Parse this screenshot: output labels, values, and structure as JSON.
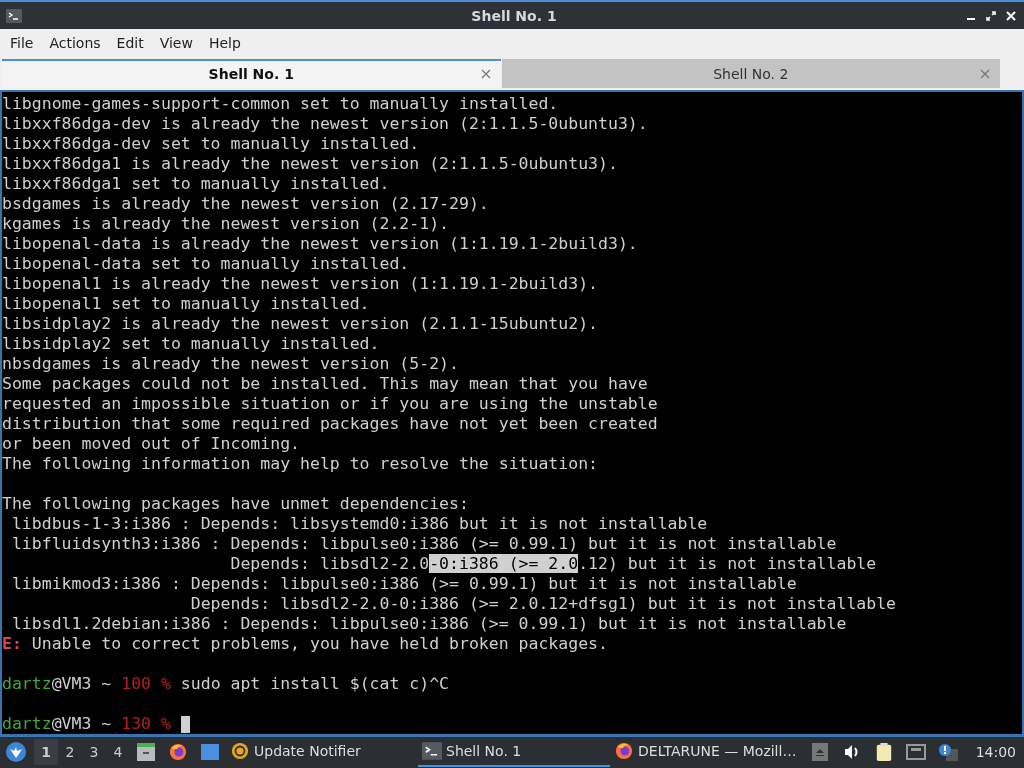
{
  "window": {
    "title": "Shell No. 1"
  },
  "menu": [
    "File",
    "Actions",
    "Edit",
    "View",
    "Help"
  ],
  "tabs": [
    {
      "label": "Shell No. 1",
      "selected": true
    },
    {
      "label": "Shell No. 2",
      "selected": false
    }
  ],
  "terminal": {
    "lines": [
      {
        "spans": [
          {
            "kind": "plain",
            "text": "libgnome-games-support-common set to manually installed."
          }
        ]
      },
      {
        "spans": [
          {
            "kind": "plain",
            "text": "libxxf86dga-dev is already the newest version (2:1.1.5-0ubuntu3)."
          }
        ]
      },
      {
        "spans": [
          {
            "kind": "plain",
            "text": "libxxf86dga-dev set to manually installed."
          }
        ]
      },
      {
        "spans": [
          {
            "kind": "plain",
            "text": "libxxf86dga1 is already the newest version (2:1.1.5-0ubuntu3)."
          }
        ]
      },
      {
        "spans": [
          {
            "kind": "plain",
            "text": "libxxf86dga1 set to manually installed."
          }
        ]
      },
      {
        "spans": [
          {
            "kind": "plain",
            "text": "bsdgames is already the newest version (2.17-29)."
          }
        ]
      },
      {
        "spans": [
          {
            "kind": "plain",
            "text": "kgames is already the newest version (2.2-1)."
          }
        ]
      },
      {
        "spans": [
          {
            "kind": "plain",
            "text": "libopenal-data is already the newest version (1:1.19.1-2build3)."
          }
        ]
      },
      {
        "spans": [
          {
            "kind": "plain",
            "text": "libopenal-data set to manually installed."
          }
        ]
      },
      {
        "spans": [
          {
            "kind": "plain",
            "text": "libopenal1 is already the newest version (1:1.19.1-2build3)."
          }
        ]
      },
      {
        "spans": [
          {
            "kind": "plain",
            "text": "libopenal1 set to manually installed."
          }
        ]
      },
      {
        "spans": [
          {
            "kind": "plain",
            "text": "libsidplay2 is already the newest version (2.1.1-15ubuntu2)."
          }
        ]
      },
      {
        "spans": [
          {
            "kind": "plain",
            "text": "libsidplay2 set to manually installed."
          }
        ]
      },
      {
        "spans": [
          {
            "kind": "plain",
            "text": "nbsdgames is already the newest version (5-2)."
          }
        ]
      },
      {
        "spans": [
          {
            "kind": "plain",
            "text": "Some packages could not be installed. This may mean that you have"
          }
        ]
      },
      {
        "spans": [
          {
            "kind": "plain",
            "text": "requested an impossible situation or if you are using the unstable"
          }
        ]
      },
      {
        "spans": [
          {
            "kind": "plain",
            "text": "distribution that some required packages have not yet been created"
          }
        ]
      },
      {
        "spans": [
          {
            "kind": "plain",
            "text": "or been moved out of Incoming."
          }
        ]
      },
      {
        "spans": [
          {
            "kind": "plain",
            "text": "The following information may help to resolve the situation:"
          }
        ]
      },
      {
        "kind": "blank"
      },
      {
        "spans": [
          {
            "kind": "plain",
            "text": "The following packages have unmet dependencies:"
          }
        ]
      },
      {
        "spans": [
          {
            "kind": "plain",
            "text": " libdbus-1-3:i386 : Depends: libsystemd0:i386 but it is not installable"
          }
        ]
      },
      {
        "spans": [
          {
            "kind": "plain",
            "text": " libfluidsynth3:i386 : Depends: libpulse0:i386 (>= 0.99.1) but it is not installable"
          }
        ]
      },
      {
        "spans": [
          {
            "kind": "plain",
            "text": "                       Depends: libsdl2-2.0"
          },
          {
            "kind": "selected",
            "text": "-0:i386 (>= 2.0"
          },
          {
            "kind": "plain",
            "text": ".12) but it is not installable"
          }
        ]
      },
      {
        "spans": [
          {
            "kind": "plain",
            "text": " libmikmod3:i386 : Depends: libpulse0:i386 (>= 0.99.1) but it is not installable"
          }
        ]
      },
      {
        "spans": [
          {
            "kind": "plain",
            "text": "                   Depends: libsdl2-2.0-0:i386 (>= 2.0.12+dfsg1) but it is not installable"
          }
        ]
      },
      {
        "spans": [
          {
            "kind": "plain",
            "text": " libsdl1.2debian:i386 : Depends: libpulse0:i386 (>= 0.99.1) but it is not installable"
          }
        ]
      },
      {
        "spans": [
          {
            "kind": "error",
            "text": "E:"
          },
          {
            "kind": "plain",
            "text": " Unable to correct problems, you have held broken packages."
          }
        ]
      },
      {
        "kind": "blank"
      },
      {
        "spans": [
          {
            "kind": "user",
            "text": "dartz"
          },
          {
            "kind": "plain",
            "text": "@VM3 ~ "
          },
          {
            "kind": "status",
            "text": "100 %"
          },
          {
            "kind": "plain",
            "text": " sudo apt install $(cat c)^C"
          }
        ]
      },
      {
        "kind": "blank"
      },
      {
        "spans": [
          {
            "kind": "user",
            "text": "dartz"
          },
          {
            "kind": "plain",
            "text": "@VM3 ~ "
          },
          {
            "kind": "status",
            "text": "130 %"
          }
        ],
        "cursor": true
      }
    ]
  },
  "taskbar": {
    "workspaces": [
      {
        "label": "1",
        "selected": true
      },
      {
        "label": "2",
        "selected": false
      },
      {
        "label": "3",
        "selected": false
      },
      {
        "label": "4",
        "selected": false
      }
    ],
    "tasks": [
      {
        "kind": "notifier",
        "label": "Update Notifier",
        "selected": false
      },
      {
        "kind": "terminal",
        "label": "Shell No. 1",
        "selected": true
      },
      {
        "kind": "browser",
        "label": "DELTARUNE — Mozill…",
        "selected": false
      }
    ],
    "clock": "14:00"
  }
}
